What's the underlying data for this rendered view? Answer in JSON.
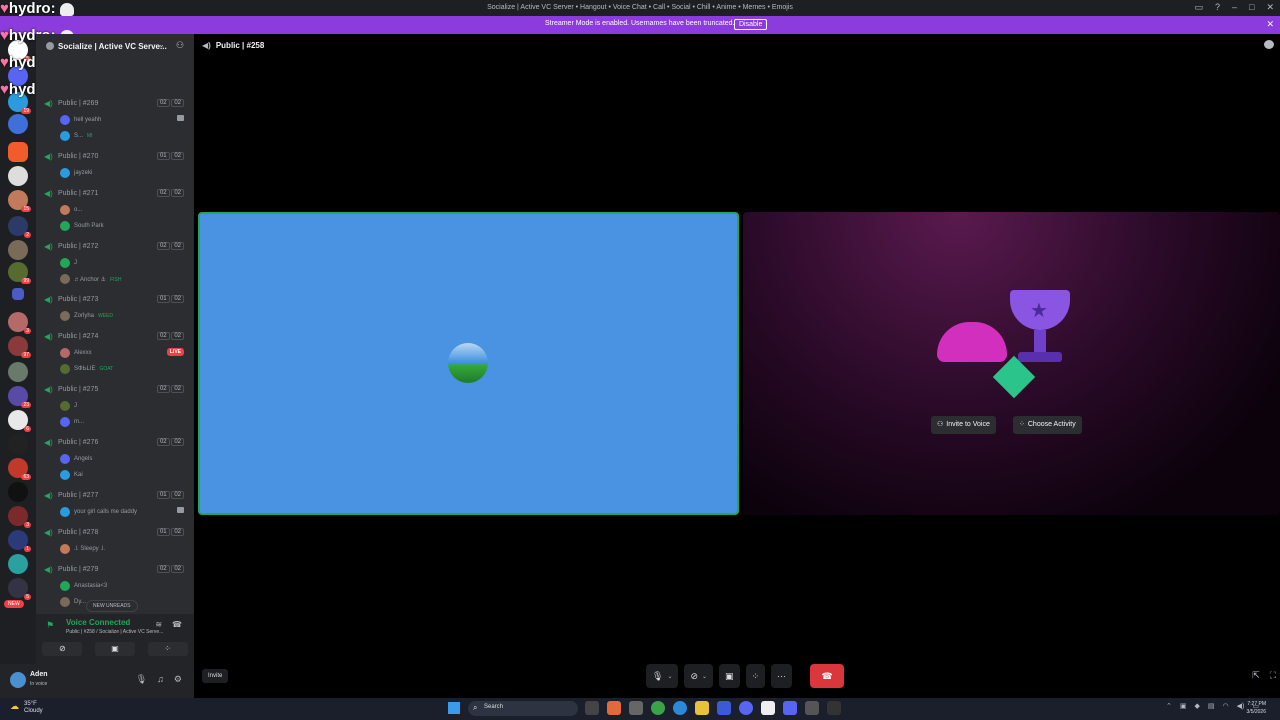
{
  "titlebar": {
    "title": "Socialize | Active VC Server • Hangout • Voice Chat • Call • Social • Chill • Anime • Memes • Emojis"
  },
  "streamer_bar": {
    "message": "Streamer Mode is enabled. Usernames have been truncated.",
    "button": "Disable"
  },
  "overlay": {
    "text": "hydro:"
  },
  "guild_badges": [
    "5",
    "19",
    "15",
    "2",
    "99",
    "3",
    "97",
    "23",
    "6",
    "63",
    "3",
    "1",
    "5"
  ],
  "new_pill": "NEW",
  "server": {
    "name": "Socialize | Active VC Serve..."
  },
  "channels": [
    {
      "name": "Public | #269",
      "count_a": "02",
      "count_b": "02",
      "members": [
        {
          "name": "hell yeahh",
          "indicator": "cam"
        },
        {
          "name": "S...",
          "tag": "MI"
        }
      ]
    },
    {
      "name": "Public | #270",
      "count_a": "01",
      "count_b": "02",
      "members": [
        {
          "name": "jayzeki"
        }
      ]
    },
    {
      "name": "Public | #271",
      "count_a": "02",
      "count_b": "02",
      "members": [
        {
          "name": "o..."
        },
        {
          "name": "South Park"
        }
      ]
    },
    {
      "name": "Public | #272",
      "count_a": "02",
      "count_b": "02",
      "members": [
        {
          "name": "J"
        },
        {
          "name": "♬Anchor ⚓",
          "tag": "FISH"
        }
      ]
    },
    {
      "name": "Public | #273",
      "count_a": "01",
      "count_b": "02",
      "members": [
        {
          "name": "Zorlyha",
          "tag": "WEED"
        }
      ]
    },
    {
      "name": "Public | #274",
      "count_a": "02",
      "count_b": "02",
      "members": [
        {
          "name": "Alexxx",
          "indicator": "LIVE"
        },
        {
          "name": "ЅФЬLIE",
          "tag": "GOAT"
        }
      ]
    },
    {
      "name": "Public | #275",
      "count_a": "02",
      "count_b": "02",
      "members": [
        {
          "name": "J"
        },
        {
          "name": "m..."
        }
      ]
    },
    {
      "name": "Public | #276",
      "count_a": "02",
      "count_b": "02",
      "members": [
        {
          "name": "Angels"
        },
        {
          "name": "Kai"
        }
      ]
    },
    {
      "name": "Public | #277",
      "count_a": "01",
      "count_b": "02",
      "members": [
        {
          "name": "your girl calls me daddy",
          "indicator": "cam"
        }
      ]
    },
    {
      "name": "Public | #278",
      "count_a": "01",
      "count_b": "02",
      "members": [
        {
          "name": ".l. Sleepy .l."
        }
      ]
    },
    {
      "name": "Public | #279",
      "count_a": "02",
      "count_b": "02",
      "members": [
        {
          "name": "Anastasia<3"
        },
        {
          "name": "Dy..."
        }
      ]
    }
  ],
  "new_unreads": "NEW UNREADS",
  "voice": {
    "title": "Voice Connected",
    "subtitle": "Public | #258 / Socialize | Active VC Serve..."
  },
  "user": {
    "name": "Aden",
    "status": "In voice"
  },
  "main": {
    "channel": "Public | #258",
    "invite_to_voice": "Invite to Voice",
    "choose_activity": "Choose Activity",
    "invite": "Invite"
  },
  "taskbar": {
    "temp": "35°F",
    "weather": "Cloudy",
    "search": "Search",
    "time": "7:27 PM",
    "date": "3/5/2026"
  },
  "colors": {
    "accent": "#8c3cdd",
    "voice_green": "#23a55a",
    "hangup": "#da373c",
    "tile_blue": "#4a93e2"
  }
}
